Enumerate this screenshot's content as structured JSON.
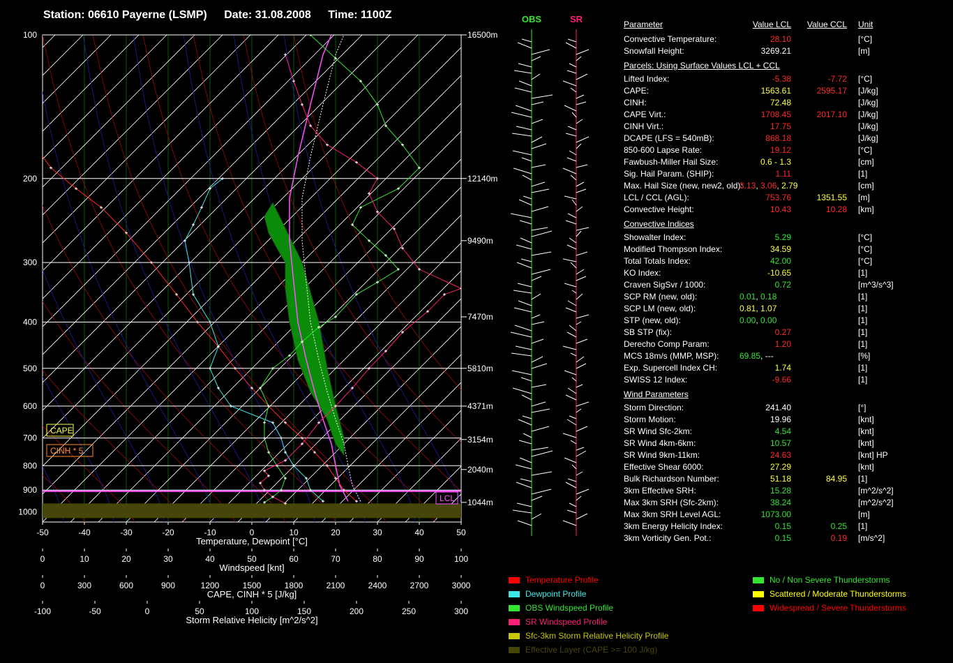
{
  "title": {
    "station": "Station: 06610 Payerne (LSMP)",
    "date": "Date: 31.08.2008",
    "time": "Time: 1100Z"
  },
  "chart_data": {
    "type": "line",
    "x_axes": [
      {
        "label": "Temperature, Dewpoint  [°C]",
        "ticks": [
          "-50",
          "-40",
          "-30",
          "-20",
          "-10",
          "0",
          "10",
          "20",
          "30",
          "40",
          "50"
        ]
      },
      {
        "label": "Windspeed  [knt]",
        "ticks": [
          "0",
          "10",
          "20",
          "30",
          "40",
          "50",
          "60",
          "70",
          "80",
          "90",
          "100"
        ]
      },
      {
        "label": "CAPE, CINH * 5  [J/kg]",
        "ticks": [
          "0",
          "300",
          "600",
          "900",
          "1200",
          "1500",
          "1800",
          "2100",
          "2400",
          "2700",
          "3000"
        ]
      },
      {
        "label": "Storm Relative Helicity  [m^2/s^2]",
        "ticks": [
          "-100",
          "-50",
          "0",
          "50",
          "100",
          "150",
          "200",
          "250",
          "300"
        ]
      }
    ],
    "pressure_ticks": [
      "100",
      "200",
      "300",
      "400",
      "500",
      "600",
      "700",
      "800",
      "900",
      "1000"
    ],
    "height_labels": [
      "16500m",
      "12140m",
      "9490m",
      "7470m",
      "5810m",
      "4371m",
      "3154m",
      "2040m",
      "1044m"
    ],
    "xlim": [
      -50,
      50
    ],
    "ylim_hpa": [
      1050,
      100
    ],
    "series": [
      {
        "name": "Temperature Profile",
        "color": "#ff2828",
        "points": [
          [
            25,
            950
          ],
          [
            22,
            900
          ],
          [
            20,
            850
          ],
          [
            18,
            800
          ],
          [
            15,
            750
          ],
          [
            12,
            700
          ],
          [
            8,
            650
          ],
          [
            4,
            600
          ],
          [
            0,
            550
          ],
          [
            -4,
            500
          ],
          [
            -8,
            450
          ],
          [
            -13,
            400
          ],
          [
            -18,
            350
          ],
          [
            -24,
            300
          ],
          [
            -30,
            260
          ],
          [
            -36,
            230
          ],
          [
            -42,
            210
          ],
          [
            -48,
            190
          ],
          [
            -52,
            170
          ],
          [
            -55,
            150
          ],
          [
            -57,
            130
          ],
          [
            -56,
            115
          ]
        ]
      },
      {
        "name": "Dewpoint Profile",
        "color": "#3ce6e6",
        "points": [
          [
            17,
            950
          ],
          [
            14,
            900
          ],
          [
            13,
            850
          ],
          [
            10,
            800
          ],
          [
            8,
            750
          ],
          [
            7,
            700
          ],
          [
            5,
            650
          ],
          [
            -5,
            600
          ],
          [
            -8,
            550
          ],
          [
            -10,
            500
          ],
          [
            -8,
            450
          ],
          [
            -10,
            400
          ],
          [
            -14,
            350
          ],
          [
            -15,
            300
          ],
          [
            -16,
            270
          ],
          [
            -14,
            250
          ],
          [
            -12,
            230
          ],
          [
            -10,
            210
          ],
          [
            -7,
            200
          ]
        ]
      },
      {
        "name": "OBS Windspeed Profile",
        "color": "#32e632",
        "points": [
          [
            3,
            955
          ],
          [
            5,
            930
          ],
          [
            7,
            900
          ],
          [
            8,
            850
          ],
          [
            6,
            800
          ],
          [
            4,
            750
          ],
          [
            3,
            700
          ],
          [
            3,
            650
          ],
          [
            4,
            600
          ],
          [
            2,
            550
          ],
          [
            5,
            500
          ],
          [
            9,
            470
          ],
          [
            12,
            440
          ],
          [
            16,
            410
          ],
          [
            20,
            390
          ],
          [
            25,
            350
          ],
          [
            30,
            330
          ],
          [
            35,
            310
          ],
          [
            32,
            290
          ],
          [
            28,
            270
          ],
          [
            24,
            250
          ],
          [
            26,
            230
          ],
          [
            35,
            210
          ],
          [
            40,
            190
          ],
          [
            36,
            170
          ],
          [
            32,
            155
          ],
          [
            30,
            140
          ],
          [
            26,
            125
          ],
          [
            20,
            112
          ],
          [
            14,
            100
          ]
        ]
      },
      {
        "name": "SR Windspeed Profile",
        "color": "#ff1e78",
        "points": [
          [
            8,
            960
          ],
          [
            5,
            930
          ],
          [
            3,
            900
          ],
          [
            2,
            870
          ],
          [
            4,
            840
          ],
          [
            3,
            820
          ],
          [
            8,
            780
          ],
          [
            12,
            720
          ],
          [
            16,
            650
          ],
          [
            20,
            600
          ],
          [
            24,
            550
          ],
          [
            28,
            500
          ],
          [
            32,
            460
          ],
          [
            36,
            420
          ],
          [
            42,
            380
          ],
          [
            46,
            350
          ],
          [
            50,
            340
          ],
          [
            40,
            310
          ],
          [
            36,
            280
          ],
          [
            34,
            255
          ],
          [
            30,
            235
          ],
          [
            28,
            215
          ],
          [
            30,
            200
          ],
          [
            25,
            185
          ],
          [
            18,
            170
          ],
          [
            14,
            155
          ],
          [
            12,
            140
          ],
          [
            10,
            125
          ],
          [
            8,
            110
          ]
        ]
      }
    ],
    "cape_area_color": "#0a8c0a",
    "cape_label": "CAPE",
    "cinh_label": "CINH * 5",
    "lcl_label": "LCL",
    "hodo_columns": [
      {
        "label": "OBS",
        "color": "#32e632"
      },
      {
        "label": "SR",
        "color": "#ff1e78"
      }
    ]
  },
  "params": {
    "header": {
      "parameter": "Parameter",
      "lcl": "Value LCL",
      "ccl": "Value CCL",
      "unit": "Unit"
    },
    "rows": [
      {
        "label": "Convective Temperature:",
        "lcl": "28.10",
        "lcl_color": "#ff2828",
        "ccl": "",
        "ccl_color": "#ffffff",
        "unit": "[°C]"
      },
      {
        "label": "Snowfall Height:",
        "lcl": "3269.21",
        "lcl_color": "#ffffff",
        "ccl": "",
        "ccl_color": "#ffffff",
        "unit": "[m]"
      },
      {
        "label": "Parcels: Using Surface Values LCL + CCL",
        "header": true
      },
      {
        "label": "Lifted Index:",
        "lcl": "-5.38",
        "lcl_color": "#ff2828",
        "ccl": "-7.72",
        "ccl_color": "#ff2828",
        "unit": "[°C]"
      },
      {
        "label": "CAPE:",
        "lcl": "1563.61",
        "lcl_color": "#ffff3c",
        "ccl": "2595.17",
        "ccl_color": "#ff2828",
        "unit": "[J/kg]"
      },
      {
        "label": "CINH:",
        "lcl": "72.48",
        "lcl_color": "#ffff3c",
        "ccl": "",
        "ccl_color": "#ffffff",
        "unit": "[J/kg]"
      },
      {
        "label": "CAPE Virt.:",
        "lcl": "1708.45",
        "lcl_color": "#ff2828",
        "ccl": "2017.10",
        "ccl_color": "#ff2828",
        "unit": "[J/kg]"
      },
      {
        "label": "CINH Virt.:",
        "lcl": "17.75",
        "lcl_color": "#ff2828",
        "ccl": "",
        "ccl_color": "#ffffff",
        "unit": "[J/kg]"
      },
      {
        "label": "DCAPE (LFS = 540mB):",
        "lcl": "868.18",
        "lcl_color": "#ff2828",
        "ccl": "",
        "ccl_color": "#ffffff",
        "unit": "[J/kg]"
      },
      {
        "label": "850-600 Lapse Rate:",
        "lcl": "19.12",
        "lcl_color": "#ff2828",
        "ccl": "",
        "ccl_color": "#ffffff",
        "unit": "[°C]"
      },
      {
        "label": "Fawbush-Miller Hail Size:",
        "lcl": "0.6 - 1.3",
        "lcl_color": "#ffff3c",
        "ccl": "",
        "ccl_color": "#ffffff",
        "unit": "[cm]"
      },
      {
        "label": "Sig. Hail Param. (SHIP):",
        "lcl": "1.11",
        "lcl_color": "#ff2828",
        "ccl": "",
        "ccl_color": "#ffffff",
        "unit": "[1]"
      },
      {
        "label": "Max. Hail Size (new, new2, old):",
        "multi": [
          {
            "t": "3.13",
            "c": "#ff2828"
          },
          {
            "t": ", ",
            "c": "#ffffff"
          },
          {
            "t": "3.06",
            "c": "#ff2828"
          },
          {
            "t": ", ",
            "c": "#ffffff"
          },
          {
            "t": "2.79",
            "c": "#ffff3c"
          }
        ],
        "unit": "[cm]"
      },
      {
        "label": "LCL / CCL (AGL):",
        "lcl": "753.76",
        "lcl_color": "#ff2828",
        "ccl": "1351.55",
        "ccl_color": "#ffff3c",
        "unit": "[m]"
      },
      {
        "label": "Convective Height:",
        "lcl": "10.43",
        "lcl_color": "#ff2828",
        "ccl": "10.28",
        "ccl_color": "#ff2828",
        "unit": "[km]"
      },
      {
        "label": "Convective Indices",
        "header": true
      },
      {
        "label": "Showalter Index:",
        "lcl": "5.29",
        "lcl_color": "#32e632",
        "ccl": "",
        "ccl_color": "#ffffff",
        "unit": "[°C]"
      },
      {
        "label": "Modified Thompson Index:",
        "lcl": "34.59",
        "lcl_color": "#ffff3c",
        "ccl": "",
        "ccl_color": "#ffffff",
        "unit": "[°C]"
      },
      {
        "label": "Total Totals Index:",
        "lcl": "42.00",
        "lcl_color": "#32e632",
        "ccl": "",
        "ccl_color": "#ffffff",
        "unit": "[°C]"
      },
      {
        "label": "KO Index:",
        "lcl": "-10.65",
        "lcl_color": "#ffff3c",
        "ccl": "",
        "ccl_color": "#ffffff",
        "unit": "[1]"
      },
      {
        "label": "Craven SigSvr / 1000:",
        "lcl": "0.72",
        "lcl_color": "#32e632",
        "ccl": "",
        "ccl_color": "#ffffff",
        "unit": "[m^3/s^3]"
      },
      {
        "label": "SCP RM (new, old):",
        "multi": [
          {
            "t": "0.01",
            "c": "#32e632"
          },
          {
            "t": ",  ",
            "c": "#ffffff"
          },
          {
            "t": "0.18",
            "c": "#32e632"
          }
        ],
        "unit": "[1]"
      },
      {
        "label": "SCP LM (new, old):",
        "multi": [
          {
            "t": "0.81",
            "c": "#ffff3c"
          },
          {
            "t": ",  ",
            "c": "#ffffff"
          },
          {
            "t": "1.07",
            "c": "#ffff3c"
          }
        ],
        "unit": "[1]"
      },
      {
        "label": "STP (new, old):",
        "multi": [
          {
            "t": "0.00",
            "c": "#32e632"
          },
          {
            "t": ",  ",
            "c": "#ffffff"
          },
          {
            "t": "0.00",
            "c": "#32e632"
          }
        ],
        "unit": "[1]"
      },
      {
        "label": "SB STP (fix):",
        "lcl": "0.27",
        "lcl_color": "#ff2828",
        "ccl": "",
        "ccl_color": "#ffffff",
        "unit": "[1]"
      },
      {
        "label": "Derecho Comp Param:",
        "lcl": "1.20",
        "lcl_color": "#ff2828",
        "ccl": "",
        "ccl_color": "#ffffff",
        "unit": "[1]"
      },
      {
        "label": "MCS 18m/s (MMP, MSP):",
        "multi": [
          {
            "t": "69.85",
            "c": "#32e632"
          },
          {
            "t": ",  ---",
            "c": "#ffffff"
          }
        ],
        "unit": "[%]"
      },
      {
        "label": "Exp. Supercell Index CH:",
        "lcl": "1.74",
        "lcl_color": "#ffff3c",
        "ccl": "",
        "ccl_color": "#ffffff",
        "unit": "[1]"
      },
      {
        "label": "SWISS 12 Index:",
        "lcl": "-9.66",
        "lcl_color": "#ff2828",
        "ccl": "",
        "ccl_color": "#ffffff",
        "unit": "[1]"
      },
      {
        "label": "Wind Parameters",
        "header": true
      },
      {
        "label": "Storm Direction:",
        "lcl": "241.40",
        "lcl_color": "#ffffff",
        "ccl": "",
        "ccl_color": "#ffffff",
        "unit": "[°]"
      },
      {
        "label": "Storm Motion:",
        "lcl": "19.96",
        "lcl_color": "#ffffff",
        "ccl": "",
        "ccl_color": "#ffffff",
        "unit": "[knt]"
      },
      {
        "label": "SR Wind Sfc-2km:",
        "lcl": "4.54",
        "lcl_color": "#32e632",
        "ccl": "",
        "ccl_color": "#ffffff",
        "unit": "[knt]"
      },
      {
        "label": "SR Wind 4km-6km:",
        "lcl": "10.57",
        "lcl_color": "#32e632",
        "ccl": "",
        "ccl_color": "#ffffff",
        "unit": "[knt]"
      },
      {
        "label": "SR Wind 9km-11km:",
        "lcl": "24.63",
        "lcl_color": "#ff2828",
        "ccl": "",
        "ccl_color": "#ffffff",
        "unit": "[knt] HP"
      },
      {
        "label": "Effective Shear 6000:",
        "lcl": "27.29",
        "lcl_color": "#ffff3c",
        "ccl": "",
        "ccl_color": "#ffffff",
        "unit": "[knt]"
      },
      {
        "label": "Bulk Richardson Number:",
        "lcl": "51.18",
        "lcl_color": "#ffff3c",
        "ccl": "84.95",
        "ccl_color": "#ffff3c",
        "unit": "[1]"
      },
      {
        "label": "3km Effective SRH:",
        "lcl": "15.28",
        "lcl_color": "#32e632",
        "ccl": "",
        "ccl_color": "#ffffff",
        "unit": "[m^2/s^2]"
      },
      {
        "label": "Max 3km SRH (Sfc-2km):",
        "lcl": "38.24",
        "lcl_color": "#32e632",
        "ccl": "",
        "ccl_color": "#ffffff",
        "unit": "[m^2/s^2]"
      },
      {
        "label": "Max 3km SRH Level AGL:",
        "lcl": "1073.00",
        "lcl_color": "#32e632",
        "ccl": "",
        "ccl_color": "#ffffff",
        "unit": "[m]"
      },
      {
        "label": "3km Energy Helicity Index:",
        "lcl": "0.15",
        "lcl_color": "#32e632",
        "ccl": "0.25",
        "ccl_color": "#32e632",
        "unit": "[1]"
      },
      {
        "label": "3km Vorticity Gen. Pot.:",
        "lcl": "0.15",
        "lcl_color": "#32e632",
        "ccl": "0.19",
        "ccl_color": "#ff2828",
        "unit": "[m/s^2]"
      }
    ]
  },
  "legend": {
    "left": [
      {
        "label": "Temperature Profile",
        "color": "#ff0000"
      },
      {
        "label": "Dewpoint Profile",
        "color": "#3ce6e6"
      },
      {
        "label": "OBS Windspeed Profile",
        "color": "#32e632"
      },
      {
        "label": "SR Windspeed Profile",
        "color": "#ff1e78"
      },
      {
        "label": "Sfc-3km Storm Relative Helicity Profile",
        "color": "#c8c800"
      },
      {
        "label": "Effective Layer (CAPE >= 100 J/kg)",
        "color": "#46460a"
      }
    ],
    "right": [
      {
        "label": "No / Non Severe Thunderstorms",
        "color": "#32e632"
      },
      {
        "label": "Scattered / Moderate Thunderstorms",
        "color": "#ffff00"
      },
      {
        "label": "Widespread / Severe Thunderstorms",
        "color": "#ff0000"
      }
    ]
  }
}
